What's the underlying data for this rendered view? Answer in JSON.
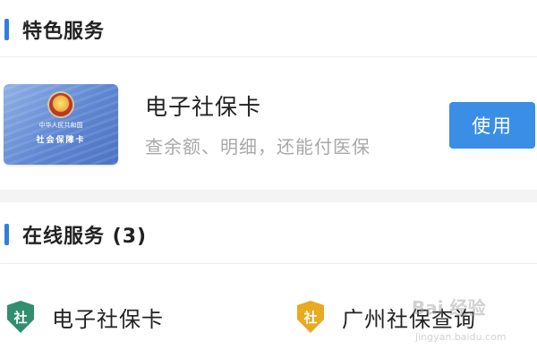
{
  "colors": {
    "accent_blue": "#2f7fe0",
    "button_blue": "#3a8ee6",
    "shield_green": "#2f8f6e",
    "shield_gold": "#e8a923"
  },
  "featured_section": {
    "title": "特色服务",
    "card": {
      "image_icon": "social-security-card-image",
      "card_country_text": "中华人民共和国",
      "card_name_text": "社会保障卡",
      "title": "电子社保卡",
      "description": "查余额、明细，还能付医保",
      "button_label": "使用"
    }
  },
  "online_section": {
    "title": "在线服务 (3)",
    "items": [
      {
        "icon": "shield-icon",
        "badge": "社",
        "label": "电子社保卡"
      },
      {
        "icon": "shield-icon",
        "badge": "社",
        "label": "广州社保查询"
      }
    ]
  },
  "watermark": {
    "logo_text": "Bai 经验",
    "url": "jingyan.baidu.com"
  }
}
